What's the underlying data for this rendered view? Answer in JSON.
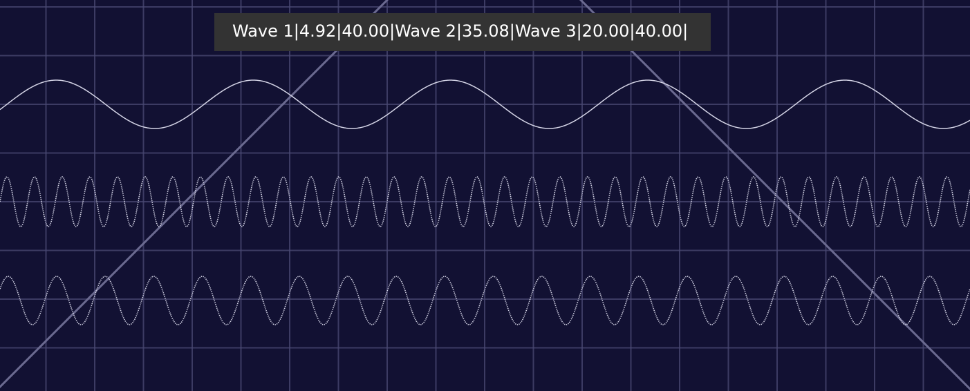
{
  "chart_data": {
    "type": "line",
    "title": "",
    "xlabel": "",
    "ylabel": "",
    "grid": true,
    "series": [
      {
        "name": "Wave 1",
        "waveform": "sine",
        "cycles": 4.92,
        "amplitude": 40.0,
        "color": "#d4d4e6",
        "line_style": "solid"
      },
      {
        "name": "Wave 2",
        "waveform": "sine",
        "cycles": 35.08,
        "amplitude": 40.0,
        "color": "#d4d4e6",
        "line_style": "dotted"
      },
      {
        "name": "Wave 3",
        "waveform": "sine",
        "cycles": 20.0,
        "amplitude": 40.0,
        "color": "#d4d4e6",
        "line_style": "dotted"
      },
      {
        "name": "",
        "waveform": "triangle",
        "color": "#6b6a90",
        "line_style": "solid"
      }
    ]
  },
  "tooltip": {
    "text": "Wave 1|4.92|40.00|Wave 2|35.08|Wave 3|20.00|40.00|"
  },
  "colors": {
    "background": "#121133",
    "grid": "#4a4a74",
    "wave": "#d4d4e6",
    "triangle": "#6b6a90",
    "tooltip_bg": "#333333"
  }
}
